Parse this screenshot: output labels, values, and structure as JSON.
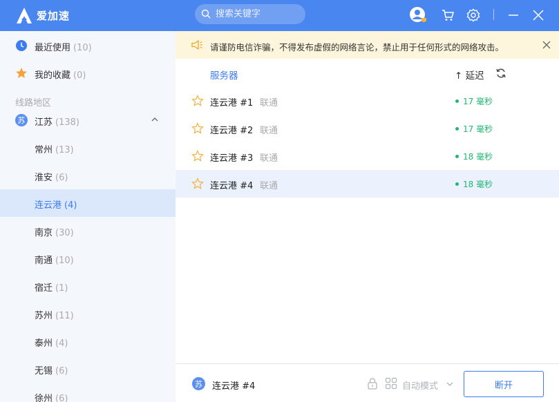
{
  "app": {
    "title": "爱加速"
  },
  "search": {
    "placeholder": "搜索关键字"
  },
  "colors": {
    "accent": "#3c7cf0",
    "header": "#4a86f0",
    "latency": "#22b573",
    "notice_bg": "#fdf6dd"
  },
  "sidebar": {
    "top_items": [
      {
        "label": "最近使用",
        "count": "(10)",
        "icon": "clock-icon"
      },
      {
        "label": "我的收藏",
        "count": "(0)",
        "icon": "star-icon"
      }
    ],
    "section_title": "线路地区",
    "province": {
      "badge": "苏",
      "label": "江苏",
      "count": "(138)"
    },
    "cities": [
      {
        "label": "常州",
        "count": "(13)"
      },
      {
        "label": "淮安",
        "count": "(6)"
      },
      {
        "label": "连云港",
        "count": "(4)"
      },
      {
        "label": "南京",
        "count": "(30)"
      },
      {
        "label": "南通",
        "count": "(10)"
      },
      {
        "label": "宿迁",
        "count": "(1)"
      },
      {
        "label": "苏州",
        "count": "(11)"
      },
      {
        "label": "泰州",
        "count": "(4)"
      },
      {
        "label": "无锡",
        "count": "(6)"
      },
      {
        "label": "徐州",
        "count": "(6)"
      }
    ]
  },
  "notice": {
    "text": "请谨防电信诈骗，不得发布虚假的网络言论，禁止用于任何形式的网络攻击。"
  },
  "list": {
    "col_server": "服务器",
    "col_latency": "↑ 延迟",
    "servers": [
      {
        "name": "连云港 #1",
        "isp": "联通",
        "latency": "17 毫秒"
      },
      {
        "name": "连云港 #2",
        "isp": "联通",
        "latency": "17 毫秒"
      },
      {
        "name": "连云港 #3",
        "isp": "联通",
        "latency": "18 毫秒"
      },
      {
        "name": "连云港 #4",
        "isp": "联通",
        "latency": "18 毫秒"
      }
    ]
  },
  "bottom": {
    "badge": "苏",
    "current": "连云港 #4",
    "mode": "自动模式",
    "disconnect": "断开"
  }
}
